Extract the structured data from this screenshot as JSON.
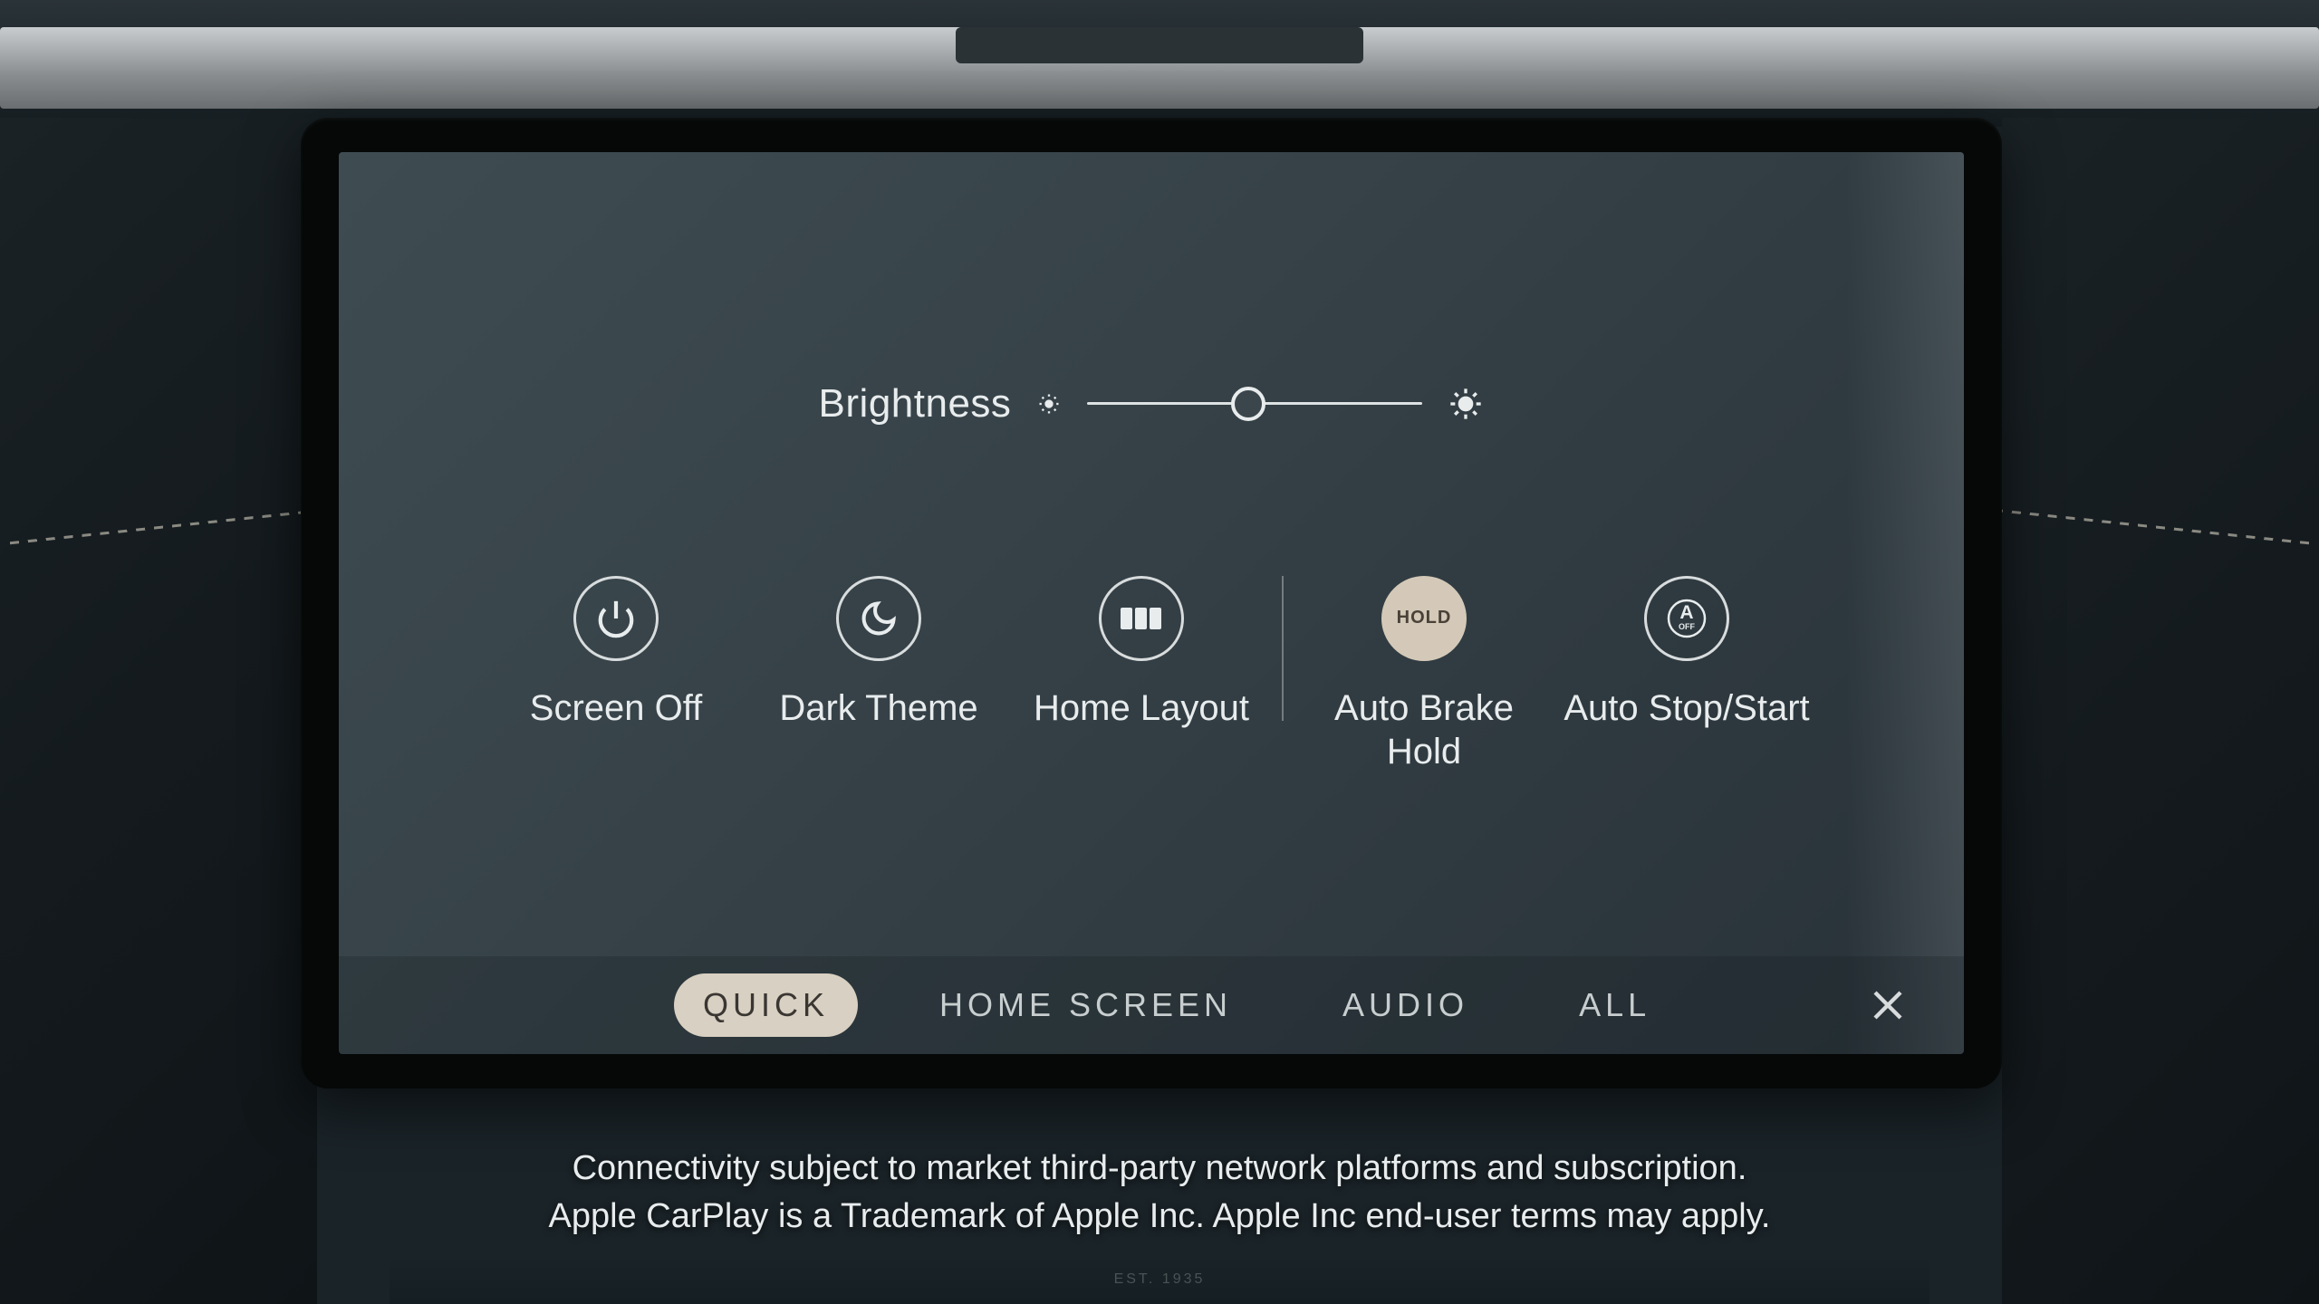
{
  "brightness": {
    "label": "Brightness",
    "value_percent": 48
  },
  "quickActions": {
    "screenOff": {
      "label": "Screen Off"
    },
    "darkTheme": {
      "label": "Dark Theme"
    },
    "homeLayout": {
      "label": "Home Layout"
    },
    "autoBrakeHold": {
      "label": "Auto Brake Hold",
      "iconText": "HOLD",
      "active": true
    },
    "autoStopStart": {
      "label": "Auto Stop/Start",
      "iconSub": "OFF"
    }
  },
  "tabs": {
    "quick": "QUICK",
    "homeScreen": "HOME SCREEN",
    "audio": "AUDIO",
    "all": "ALL",
    "activeTab": "quick"
  },
  "disclaimer": {
    "line1": "Connectivity subject to market third-party network platforms and subscription.",
    "line2": "Apple CarPlay is a Trademark of Apple Inc. Apple Inc end-user terms may apply."
  },
  "lowerBadge": "EST. 1935",
  "colors": {
    "screenBg": "#364248",
    "accentBeige": "#d4c9b8",
    "textLight": "#e8eced"
  }
}
